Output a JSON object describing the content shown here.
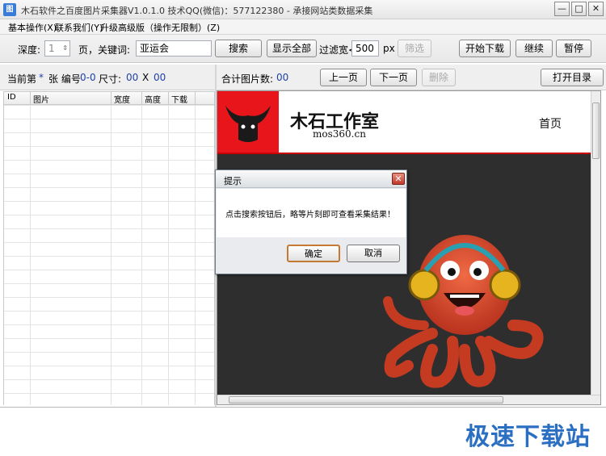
{
  "window": {
    "title": "木石软件之百度图片采集器V1.0.1.0  技术QQ(微信)：577122380  - 承接网站类数据采集",
    "icon": "app-icon"
  },
  "menu": [
    {
      "label": "基本操作(X)"
    },
    {
      "label": "联系我们(Y)"
    },
    {
      "label": "升级高级版（操作无限制）(Z)"
    }
  ],
  "toolbar": {
    "depth_label": "深度:",
    "depth_value": "1",
    "page_keyword_label": "页，关键词:",
    "keyword_value": "亚运会",
    "search_button": "搜索",
    "show_all_button": "显示全部",
    "filter_width_label": "过滤宽<",
    "filter_width_value": "500",
    "px_label": "px",
    "filter_button": "筛选",
    "start_download_button": "开始下载",
    "continue_button": "继续",
    "pause_button": "暂停"
  },
  "left_panel": {
    "current_label": "当前第",
    "current_value": "*",
    "index_label": "张 编号",
    "index_value": "0-0",
    "size_label": "尺寸:",
    "width_value": "00",
    "x_label": "X",
    "height_value": "00",
    "columns": [
      "ID",
      "图片",
      "宽度",
      "高度",
      "下载"
    ]
  },
  "right_panel": {
    "total_label": "合计图片数:",
    "total_value": "00",
    "prev_button": "上一页",
    "next_button": "下一页",
    "delete_button": "删除",
    "open_dir_button": "打开目录"
  },
  "webpage": {
    "logo_text": "木石工作室",
    "logo_url": "mos360.cn",
    "nav_home": "首页",
    "brand_red": "#e8161b"
  },
  "dialog": {
    "title": "提示",
    "message": "点击搜索按钮后，略等片刻即可查看采集结果！",
    "ok_button": "确定",
    "cancel_button": "取消"
  },
  "watermark": "极速下载站"
}
